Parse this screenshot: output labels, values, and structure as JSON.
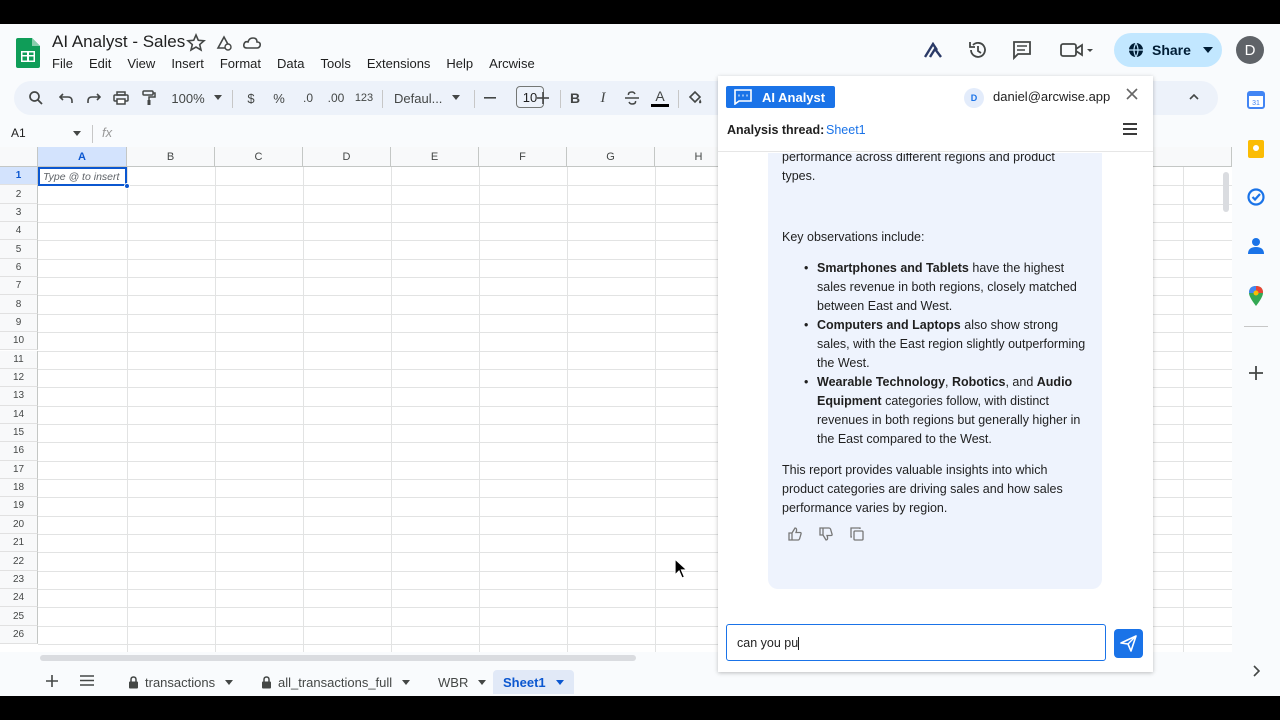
{
  "app": {
    "doc_title": "AI Analyst - Sales",
    "menu": [
      "File",
      "Edit",
      "View",
      "Insert",
      "Format",
      "Data",
      "Tools",
      "Extensions",
      "Help",
      "Arcwise"
    ],
    "share_label": "Share",
    "avatar_letter": "D"
  },
  "toolbar": {
    "zoom": "100%",
    "currency": "$",
    "percent": "%",
    "decrease_decimal": ".0",
    "increase_decimal": ".00",
    "number_format": "123",
    "font_name": "Defaul...",
    "font_size": "10",
    "bold": "B",
    "italic": "I",
    "text_color": "A"
  },
  "formula_bar": {
    "cell_ref": "A1",
    "fx": "fx"
  },
  "grid": {
    "columns": [
      "A",
      "B",
      "C",
      "D",
      "E",
      "F",
      "G",
      "H"
    ],
    "rows": [
      "1",
      "2",
      "3",
      "4",
      "5",
      "6",
      "7",
      "8",
      "9",
      "10",
      "11",
      "12",
      "13",
      "14",
      "15",
      "16",
      "17",
      "18",
      "19",
      "20",
      "21",
      "22",
      "23",
      "24",
      "25",
      "26"
    ],
    "a1_hint": "Type @ to insert"
  },
  "sheets": {
    "tabs": [
      "transactions",
      "all_transactions_full",
      "WBR",
      "Sheet1"
    ],
    "active": "Sheet1"
  },
  "ai_panel": {
    "badge_label": "AI Analyst",
    "user_initial": "D",
    "user_email": "daniel@arcwise.app",
    "thread_label": "Analysis thread:",
    "thread_name": "Sheet1",
    "message": {
      "intro": "revenue is represented, allowing us to compare performance across different regions and product types.",
      "key_heading": "Key observations include:",
      "bullets": [
        {
          "b1": "Smartphones and Tablets",
          "t1": " have the highest sales revenue in both regions, closely matched between East and West."
        },
        {
          "b1": "Computers and Laptops",
          "t1": " also show strong sales, with the East region slightly outperforming the West."
        },
        {
          "b1": "Wearable Technology",
          "t1": ", ",
          "b2": "Robotics",
          "t2": ", and ",
          "b3": "Audio Equipment",
          "t3": " categories follow, with distinct revenues in both regions but generally higher in the East compared to the West."
        }
      ],
      "closing": "This report provides valuable insights into which product categories are driving sales and how sales performance varies by region."
    },
    "input_value": "can you pu"
  },
  "colors": {
    "accent": "#1a73e8",
    "share_bg": "#c2e7ff",
    "bubble_bg": "#eef3fd"
  }
}
